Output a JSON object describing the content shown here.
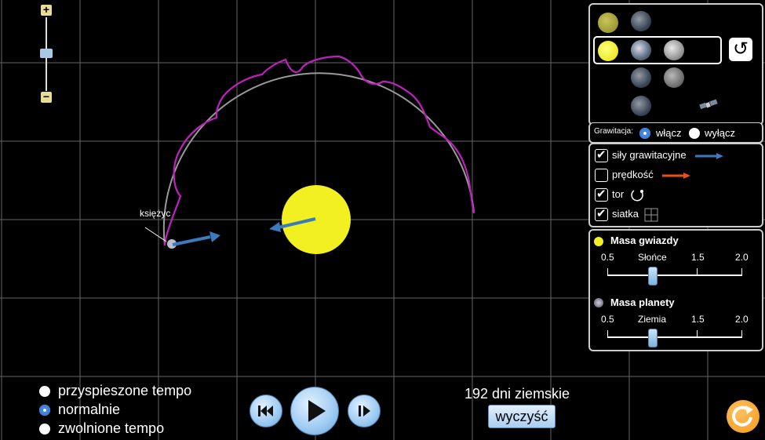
{
  "zoom": {
    "plus": "+",
    "minus": "−"
  },
  "scene": {
    "moon_label": "księżyc"
  },
  "bodies_panel": {
    "selected_row": 2
  },
  "gravity": {
    "label": "Grawitacja:",
    "on_label": "włącz",
    "off_label": "wyłącz",
    "selected": "włącz"
  },
  "options": {
    "gravity_forces": {
      "label": "siły grawitacyjne",
      "checked": true
    },
    "velocity": {
      "label": "prędkość",
      "checked": false
    },
    "path": {
      "label": "tor",
      "checked": true
    },
    "grid": {
      "label": "siatka",
      "checked": true
    }
  },
  "star_mass": {
    "title": "Masa gwiazdy",
    "ticks": [
      "0.5",
      "Słońce",
      "1.5",
      "2.0"
    ],
    "value": 1.0
  },
  "planet_mass": {
    "title": "Masa planety",
    "ticks": [
      "0.5",
      "Ziemia",
      "1.5",
      "2.0"
    ],
    "value": 1.0
  },
  "speed": {
    "fast": "przyspieszone tempo",
    "normal": "normalnie",
    "slow": "zwolnione tempo",
    "selected": "normalnie"
  },
  "time": {
    "elapsed": "192 dni ziemskie",
    "clear_label": "wyczyść"
  },
  "colors": {
    "grid": "#666666",
    "planet_path": "#c020c0",
    "moon_path": "#999999",
    "force_arrow": "#3a7abf",
    "velocity_arrow": "#e8501a",
    "sun": "#f2f020",
    "reset": "#f39a1c"
  }
}
